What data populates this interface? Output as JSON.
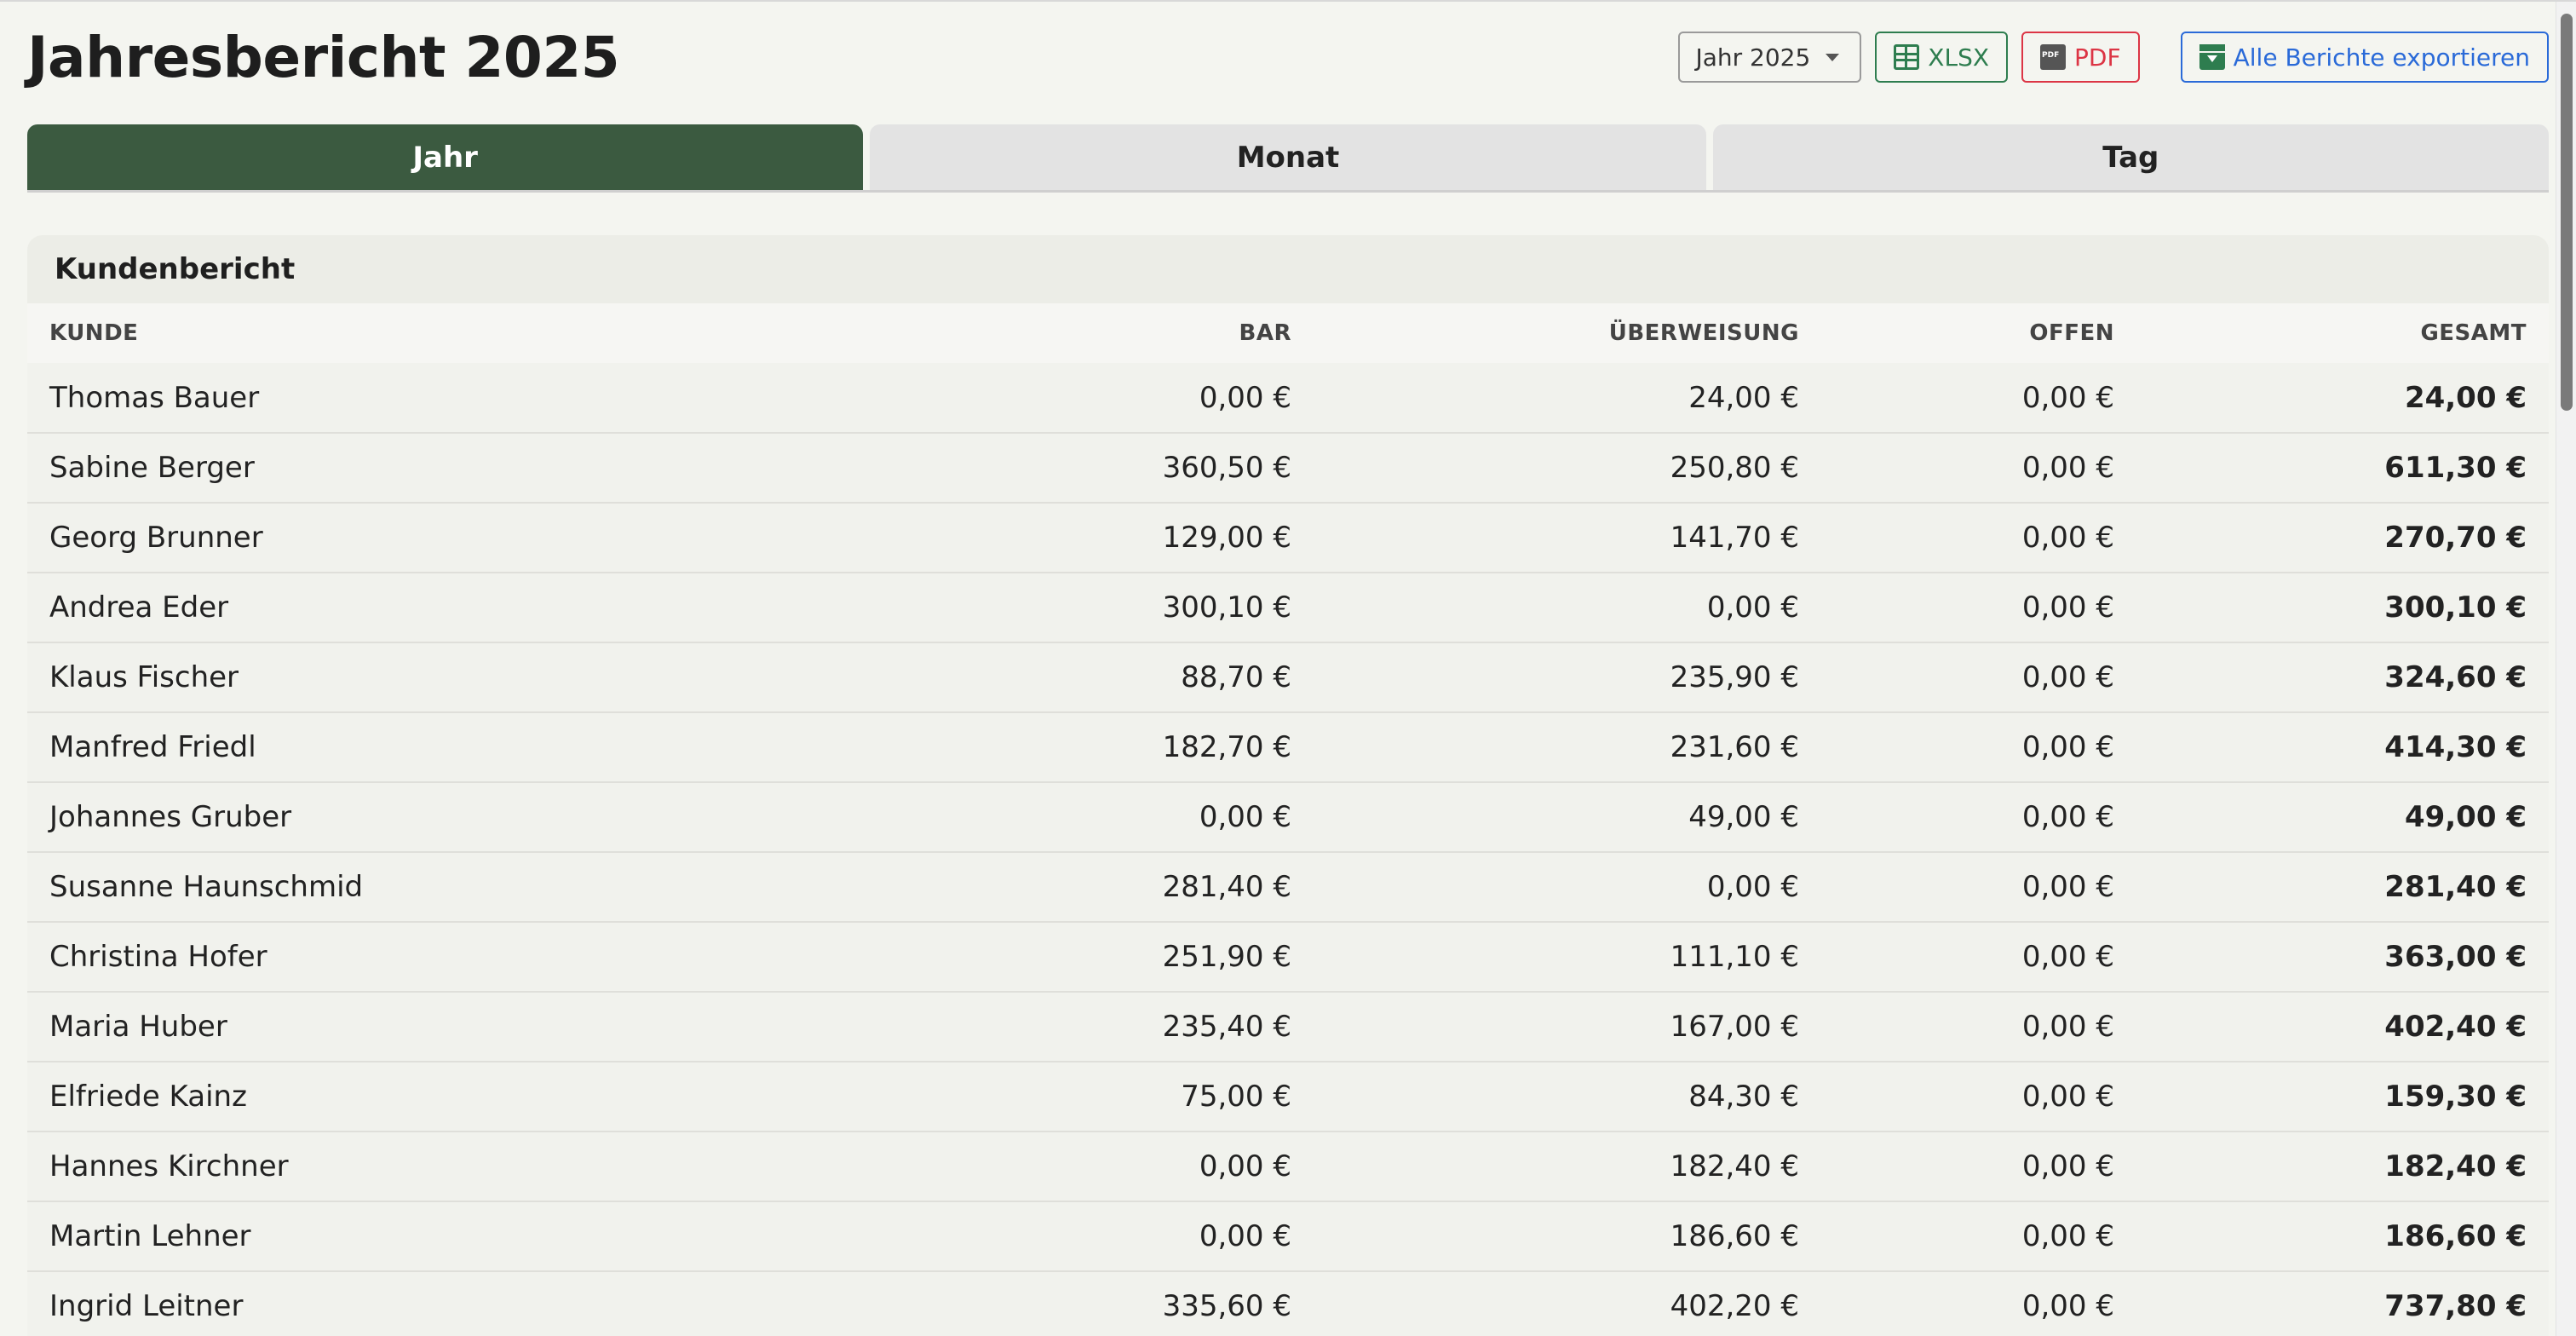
{
  "header": {
    "title": "Jahresbericht 2025",
    "year_select": "Jahr 2025",
    "xlsx_label": "XLSX",
    "pdf_label": "PDF",
    "export_label": "Alle Berichte exportieren"
  },
  "tabs": [
    {
      "label": "Jahr",
      "active": true
    },
    {
      "label": "Monat",
      "active": false
    },
    {
      "label": "Tag",
      "active": false
    }
  ],
  "report": {
    "title": "Kundenbericht",
    "columns": [
      "KUNDE",
      "BAR",
      "ÜBERWEISUNG",
      "OFFEN",
      "GESAMT"
    ],
    "rows": [
      [
        "Thomas Bauer",
        "0,00 €",
        "24,00 €",
        "0,00 €",
        "24,00 €"
      ],
      [
        "Sabine Berger",
        "360,50 €",
        "250,80 €",
        "0,00 €",
        "611,30 €"
      ],
      [
        "Georg Brunner",
        "129,00 €",
        "141,70 €",
        "0,00 €",
        "270,70 €"
      ],
      [
        "Andrea Eder",
        "300,10 €",
        "0,00 €",
        "0,00 €",
        "300,10 €"
      ],
      [
        "Klaus Fischer",
        "88,70 €",
        "235,90 €",
        "0,00 €",
        "324,60 €"
      ],
      [
        "Manfred Friedl",
        "182,70 €",
        "231,60 €",
        "0,00 €",
        "414,30 €"
      ],
      [
        "Johannes Gruber",
        "0,00 €",
        "49,00 €",
        "0,00 €",
        "49,00 €"
      ],
      [
        "Susanne Haunschmid",
        "281,40 €",
        "0,00 €",
        "0,00 €",
        "281,40 €"
      ],
      [
        "Christina Hofer",
        "251,90 €",
        "111,10 €",
        "0,00 €",
        "363,00 €"
      ],
      [
        "Maria Huber",
        "235,40 €",
        "167,00 €",
        "0,00 €",
        "402,40 €"
      ],
      [
        "Elfriede Kainz",
        "75,00 €",
        "84,30 €",
        "0,00 €",
        "159,30 €"
      ],
      [
        "Hannes Kirchner",
        "0,00 €",
        "182,40 €",
        "0,00 €",
        "182,40 €"
      ],
      [
        "Martin Lehner",
        "0,00 €",
        "186,60 €",
        "0,00 €",
        "186,60 €"
      ],
      [
        "Ingrid Leitner",
        "335,60 €",
        "402,20 €",
        "0,00 €",
        "737,80 €"
      ]
    ]
  },
  "colors": {
    "accent": "#3b5a40",
    "xlsx": "#2e7d4f",
    "pdf": "#dc3545",
    "export": "#2a6ad8"
  }
}
